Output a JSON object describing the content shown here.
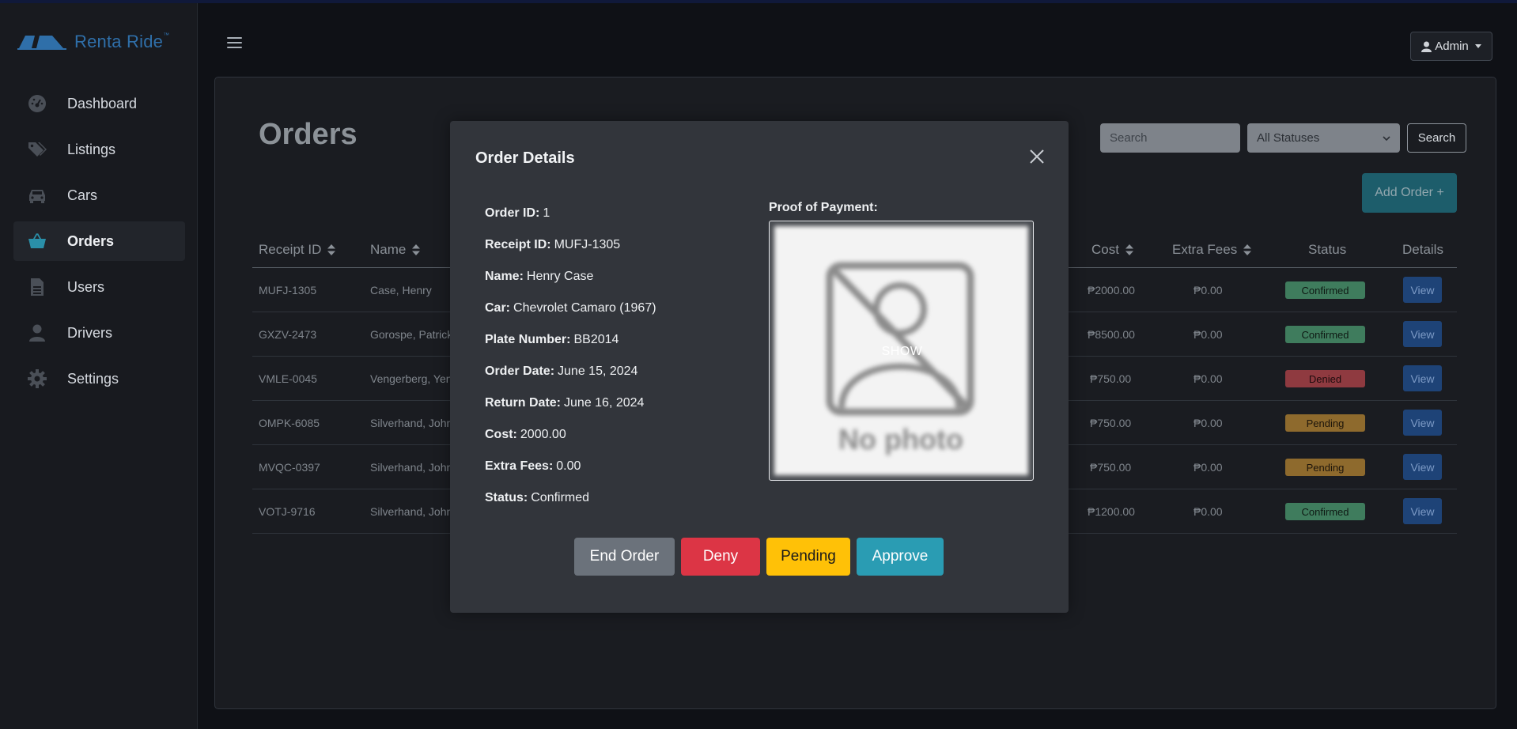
{
  "brand": {
    "name": "Renta Ride",
    "tm": "™"
  },
  "sidebar": {
    "items": [
      {
        "label": "Dashboard",
        "icon": "dashboard-gauge-icon"
      },
      {
        "label": "Listings",
        "icon": "tags-icon"
      },
      {
        "label": "Cars",
        "icon": "car-icon"
      },
      {
        "label": "Orders",
        "icon": "basket-icon",
        "active": true
      },
      {
        "label": "Users",
        "icon": "document-icon"
      },
      {
        "label": "Drivers",
        "icon": "person-icon"
      },
      {
        "label": "Settings",
        "icon": "gear-icon"
      }
    ]
  },
  "header": {
    "admin_label": "Admin"
  },
  "page": {
    "title": "Orders",
    "search_placeholder": "Search",
    "status_filter": "All Statuses",
    "search_button": "Search",
    "add_order_button": "Add Order +"
  },
  "table": {
    "columns": {
      "receipt_id": "Receipt ID",
      "name": "Name",
      "cost": "Cost",
      "extra_fees": "Extra Fees",
      "status": "Status",
      "details": "Details"
    },
    "rows": [
      {
        "receipt_id": "MUFJ-1305",
        "name": "Case, Henry",
        "cost": "₱2000.00",
        "extra_fees": "₱0.00",
        "status": "Confirmed",
        "action": "View"
      },
      {
        "receipt_id": "GXZV-2473",
        "name": "Gorospe, Patrick",
        "cost": "₱8500.00",
        "extra_fees": "₱0.00",
        "status": "Confirmed",
        "action": "View"
      },
      {
        "receipt_id": "VMLE-0045",
        "name": "Vengerberg, Yen",
        "cost": "₱750.00",
        "extra_fees": "₱0.00",
        "status": "Denied",
        "action": "View"
      },
      {
        "receipt_id": "OMPK-6085",
        "name": "Silverhand, John",
        "cost": "₱750.00",
        "extra_fees": "₱0.00",
        "status": "Pending",
        "action": "View"
      },
      {
        "receipt_id": "MVQC-0397",
        "name": "Silverhand, John",
        "cost": "₱750.00",
        "extra_fees": "₱0.00",
        "status": "Pending",
        "action": "View"
      },
      {
        "receipt_id": "VOTJ-9716",
        "name": "Silverhand, John",
        "cost": "₱1200.00",
        "extra_fees": "₱0.00",
        "status": "Confirmed",
        "action": "View"
      }
    ]
  },
  "modal": {
    "title": "Order Details",
    "details": [
      {
        "label": "Order ID:",
        "value": "1"
      },
      {
        "label": "Receipt ID:",
        "value": "MUFJ-1305"
      },
      {
        "label": "Name:",
        "value": "Henry Case"
      },
      {
        "label": "Car:",
        "value": "Chevrolet Camaro (1967)"
      },
      {
        "label": "Plate Number:",
        "value": "BB2014"
      },
      {
        "label": "Order Date:",
        "value": "June 15, 2024"
      },
      {
        "label": "Return Date:",
        "value": "June 16, 2024"
      },
      {
        "label": "Cost:",
        "value": "2000.00"
      },
      {
        "label": "Extra Fees:",
        "value": "0.00"
      },
      {
        "label": "Status:",
        "value": "Confirmed"
      }
    ],
    "proof_label": "Proof of Payment:",
    "proof_image_text": "No photo",
    "show_label": "SHOW",
    "buttons": {
      "end_order": "End Order",
      "deny": "Deny",
      "pending": "Pending",
      "approve": "Approve"
    }
  },
  "colors": {
    "accent_teal": "#2a9cb3",
    "deny_red": "#dc3545",
    "pending_yellow": "#ffc107",
    "end_gray": "#6b727b",
    "brand_blue": "#2f6fa9"
  }
}
